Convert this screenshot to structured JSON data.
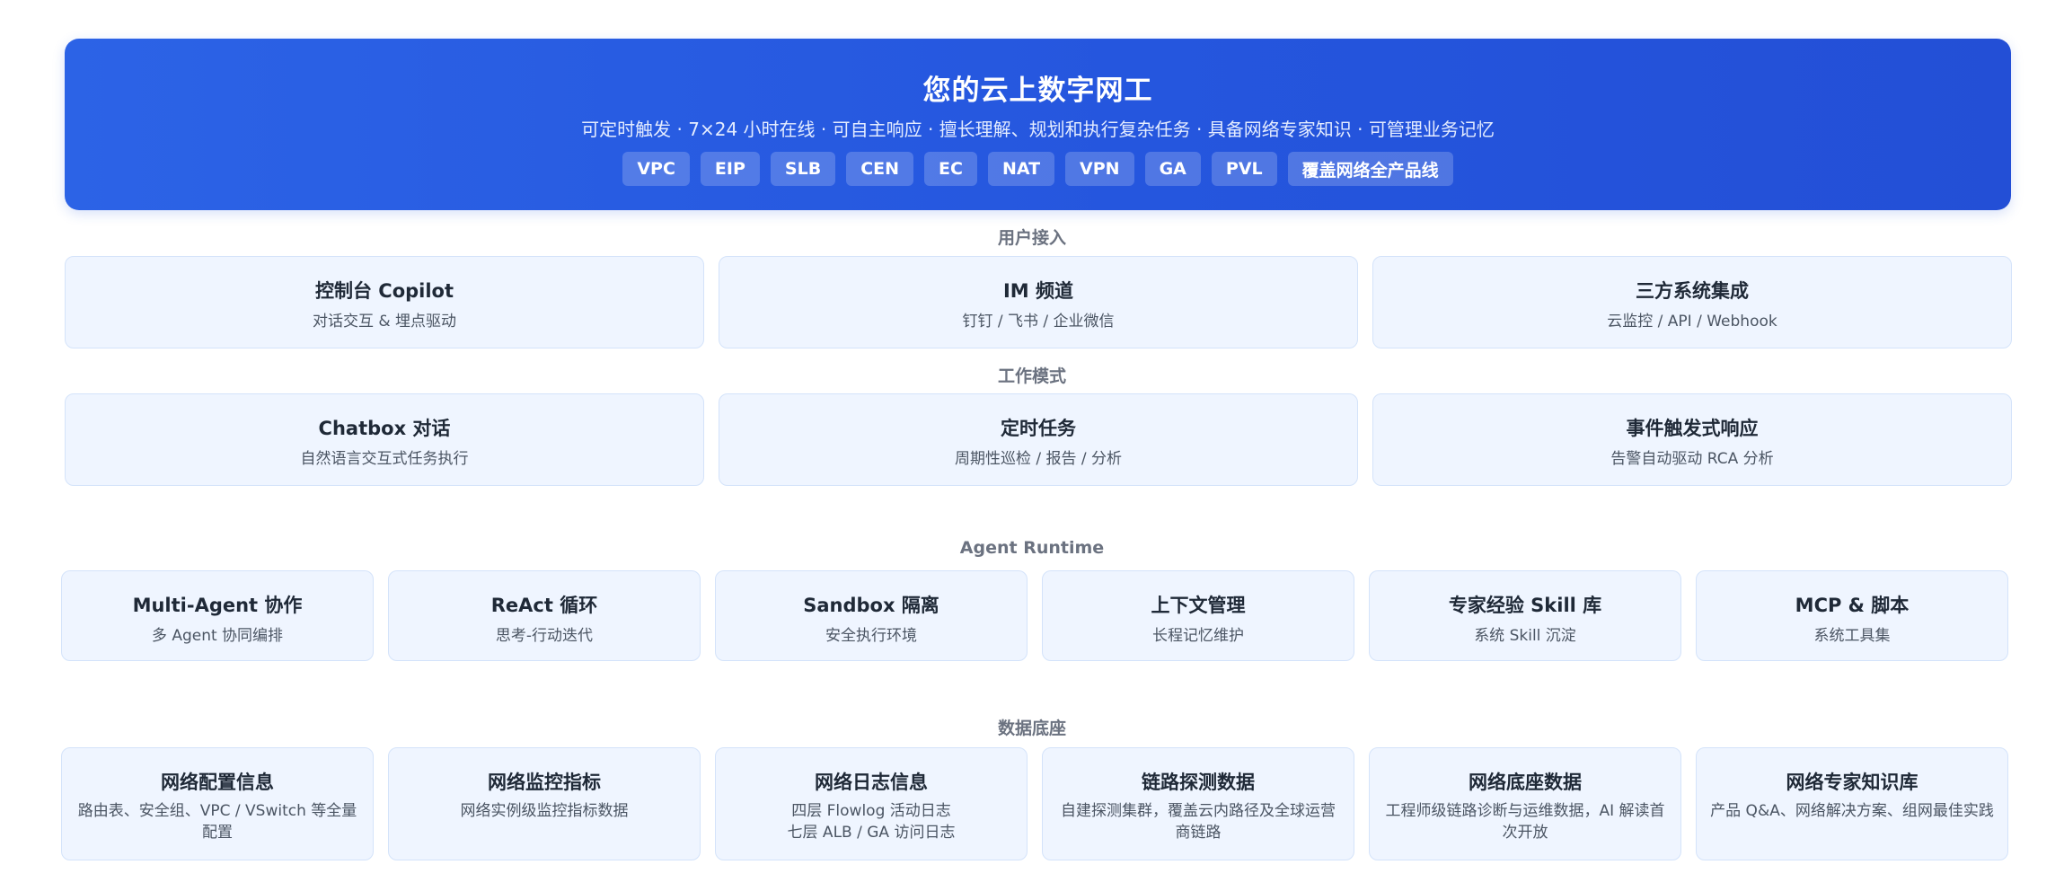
{
  "hero": {
    "title": "您的云上数字网工",
    "subtitle": "可定时触发 · 7×24 小时在线 · 可自主响应 · 擅长理解、规划和执行复杂任务 · 具备网络专家知识 · 可管理业务记忆",
    "tags": [
      "VPC",
      "EIP",
      "SLB",
      "CEN",
      "EC",
      "NAT",
      "VPN",
      "GA",
      "PVL",
      "覆盖网络全产品线"
    ]
  },
  "access": {
    "label": "用户接入",
    "cards": [
      {
        "title": "控制台 Copilot",
        "desc": "对话交互 & 埋点驱动"
      },
      {
        "title": "IM 频道",
        "desc": "钉钉 / 飞书 / 企业微信"
      },
      {
        "title": "三方系统集成",
        "desc": "云监控 / API / Webhook"
      }
    ]
  },
  "modes": {
    "label": "工作模式",
    "cards": [
      {
        "title": "Chatbox 对话",
        "desc": "自然语言交互式任务执行"
      },
      {
        "title": "定时任务",
        "desc": "周期性巡检 / 报告 / 分析"
      },
      {
        "title": "事件触发式响应",
        "desc": "告警自动驱动 RCA 分析"
      }
    ]
  },
  "runtime": {
    "label": "Agent Runtime",
    "cards": [
      {
        "title": "Multi-Agent 协作",
        "desc": "多 Agent 协同编排"
      },
      {
        "title": "ReAct 循环",
        "desc": "思考-行动迭代"
      },
      {
        "title": "Sandbox 隔离",
        "desc": "安全执行环境"
      },
      {
        "title": "上下文管理",
        "desc": "长程记忆维护"
      },
      {
        "title": "专家经验 Skill 库",
        "desc": "系统 Skill 沉淀"
      },
      {
        "title": "MCP & 脚本",
        "desc": "系统工具集"
      }
    ]
  },
  "data_layer": {
    "label": "数据底座",
    "cards": [
      {
        "title": "网络配置信息",
        "desc": "路由表、安全组、VPC / VSwitch 等全量配置"
      },
      {
        "title": "网络监控指标",
        "desc": "网络实例级监控指标数据"
      },
      {
        "title": "网络日志信息",
        "desc": "四层 Flowlog 活动日志",
        "desc2": "七层 ALB / GA 访问日志"
      },
      {
        "title": "链路探测数据",
        "desc": "自建探测集群，覆盖云内路径及全球运营商链路"
      },
      {
        "title": "网络底座数据",
        "desc": "工程师级链路诊断与运维数据，AI 解读首次开放"
      },
      {
        "title": "网络专家知识库",
        "desc": "产品 Q&A、网络解决方案、组网最佳实践"
      }
    ]
  }
}
